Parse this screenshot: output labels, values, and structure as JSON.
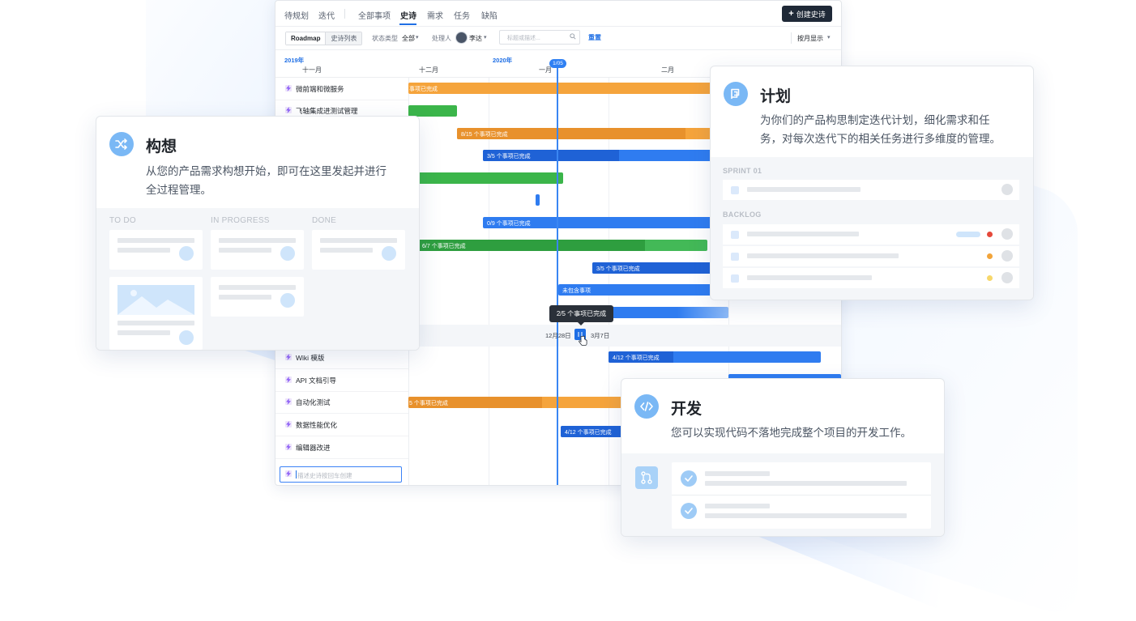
{
  "nav": {
    "items": [
      "待规划",
      "迭代",
      "全部事项",
      "史诗",
      "需求",
      "任务",
      "缺陷"
    ],
    "create_label": "创建史诗"
  },
  "toolbar": {
    "view_roadmap": "Roadmap",
    "view_list": "史诗列表",
    "status_label": "状态类型",
    "status_value": "全部",
    "assignee_label": "处理人",
    "assignee_value": "李达",
    "search_placeholder": "标题或描述...",
    "reset_label": "重置",
    "display_label": "按月显示"
  },
  "timeline": {
    "year_2019": "2019年",
    "year_2020": "2020年",
    "months": [
      "十一月",
      "十二月",
      "一月",
      "二月"
    ],
    "today": "1/05"
  },
  "epics": [
    "微前端和微服务",
    "飞轴集成进测试管理",
    "Wiki 模版",
    "API 文档引导",
    "自动化测试",
    "数据性能优化",
    "编辑器改进"
  ],
  "new_epic_placeholder": "描述史诗按回车创建",
  "bars": {
    "b1": "事项已完成",
    "b3": "8/15 个事项已完成",
    "b4": "3/5 个事项已完成",
    "b6": "0/9 个事项已完成",
    "b7": "6/7 个事项已完成",
    "b8": "3/5 个事项已完成",
    "b9": "未包含事项",
    "b11": "4/12 个事项已完成",
    "b13": "5 个事项已完成",
    "b14": "4/12 个事项已完成"
  },
  "tooltip": "2/5 个事项已完成",
  "hover_dates": {
    "start": "12月28日",
    "end": "3月7日"
  },
  "card_idea": {
    "title": "构想",
    "desc_1": "从您的产品需求构想开始，即可在这里发起并进行",
    "desc_2": "全过程管理。",
    "col_todo": "TO DO",
    "col_progress": "IN PROGRESS",
    "col_done": "DONE"
  },
  "card_plan": {
    "title": "计划",
    "desc_1": "为你们的产品构思制定迭代计划，细化需求和任",
    "desc_2": "务，对每次迭代下的相关任务进行多维度的管理。",
    "sprint": "SPRINT 01",
    "backlog": "BACKLOG"
  },
  "card_dev": {
    "title": "开发",
    "desc": "您可以实现代码不落地完成整个项目的开发工作。"
  },
  "colors": {
    "accent": "#1f6fe5",
    "orange": "#f4a23a",
    "green": "#3bb54a",
    "blue": "#2f74e8",
    "red": "#e5483a",
    "amber": "#f2a43a",
    "yellow": "#f7d76a"
  }
}
